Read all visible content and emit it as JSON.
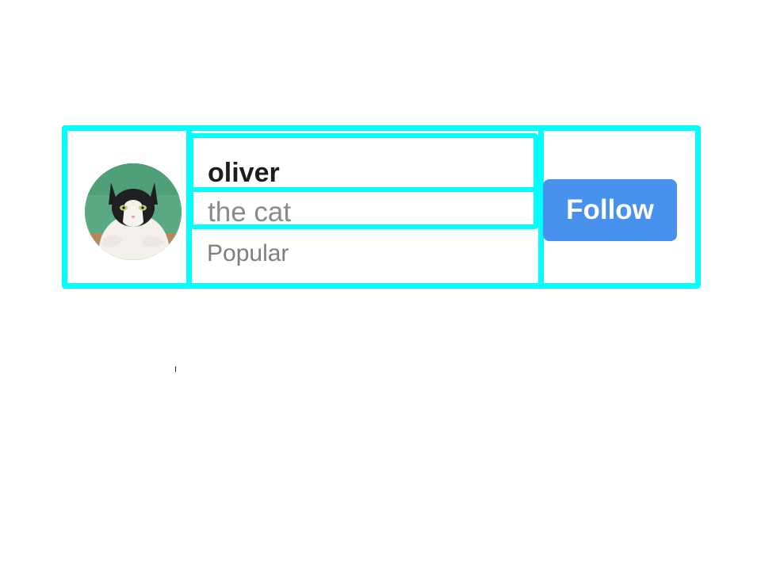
{
  "profile_card": {
    "name": "oliver",
    "subtitle": "the cat",
    "tag": "Popular",
    "avatar_icon": "cat-photo",
    "follow_label": "Follow"
  },
  "colors": {
    "highlight": "#00ffff",
    "button": "#4891ec",
    "name_text": "#1d1d1d",
    "secondary_text": "#8a8a8a"
  }
}
